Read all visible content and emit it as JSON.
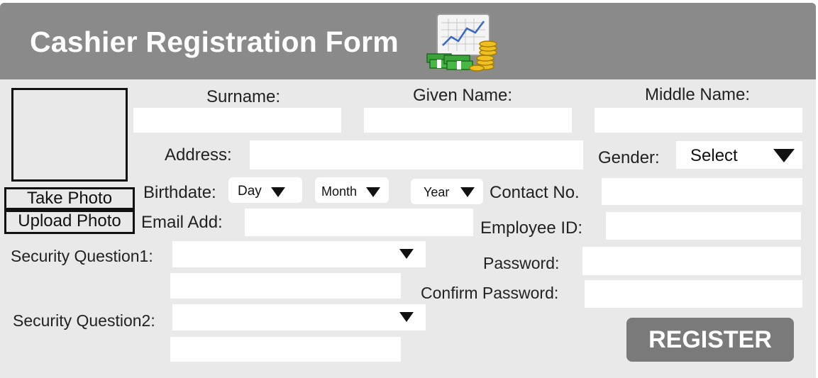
{
  "header": {
    "title": "Cashier Registration Form",
    "logo_icon": "finance-chart-money-icon"
  },
  "photo": {
    "take_label": "Take Photo",
    "upload_label": "Upload Photo"
  },
  "fields": {
    "surname_label": "Surname:",
    "given_name_label": "Given Name:",
    "middle_name_label": "Middle Name:",
    "address_label": "Address:",
    "gender_label": "Gender:",
    "gender_value": "Select",
    "birthdate_label": "Birthdate:",
    "day_value": "Day",
    "month_value": "Month",
    "year_value": "Year",
    "contact_label": "Contact No.",
    "email_label": "Email Add:",
    "employee_id_label": "Employee ID:",
    "security_q1_label": "Security Question1:",
    "security_q2_label": "Security Question2:",
    "password_label": "Password:",
    "confirm_password_label": "Confirm Password:"
  },
  "actions": {
    "register_label": "REGISTER"
  },
  "colors": {
    "header_bg": "#8a8a8a",
    "panel_bg": "#e9e9e9",
    "register_bg": "#7a7a7a"
  }
}
